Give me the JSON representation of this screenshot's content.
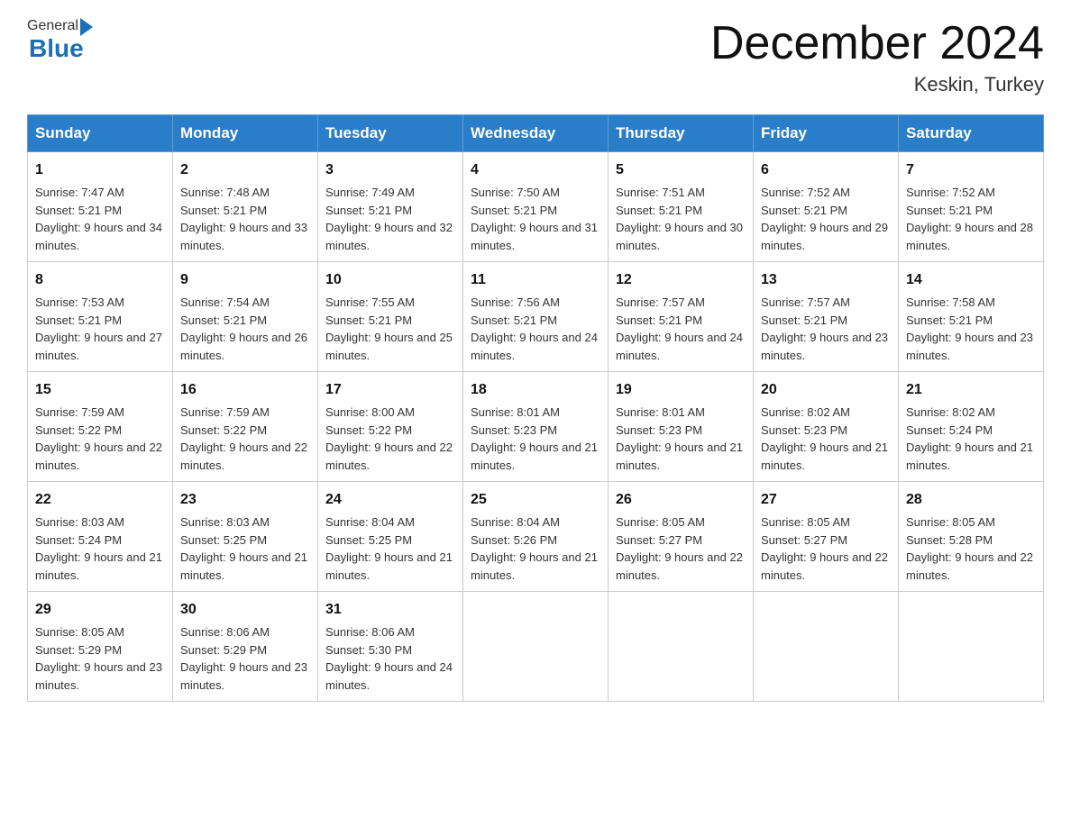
{
  "header": {
    "logo_general": "General",
    "logo_blue": "Blue",
    "month_title": "December 2024",
    "location": "Keskin, Turkey"
  },
  "weekdays": [
    "Sunday",
    "Monday",
    "Tuesday",
    "Wednesday",
    "Thursday",
    "Friday",
    "Saturday"
  ],
  "weeks": [
    [
      {
        "day": "1",
        "sunrise": "7:47 AM",
        "sunset": "5:21 PM",
        "daylight": "9 hours and 34 minutes."
      },
      {
        "day": "2",
        "sunrise": "7:48 AM",
        "sunset": "5:21 PM",
        "daylight": "9 hours and 33 minutes."
      },
      {
        "day": "3",
        "sunrise": "7:49 AM",
        "sunset": "5:21 PM",
        "daylight": "9 hours and 32 minutes."
      },
      {
        "day": "4",
        "sunrise": "7:50 AM",
        "sunset": "5:21 PM",
        "daylight": "9 hours and 31 minutes."
      },
      {
        "day": "5",
        "sunrise": "7:51 AM",
        "sunset": "5:21 PM",
        "daylight": "9 hours and 30 minutes."
      },
      {
        "day": "6",
        "sunrise": "7:52 AM",
        "sunset": "5:21 PM",
        "daylight": "9 hours and 29 minutes."
      },
      {
        "day": "7",
        "sunrise": "7:52 AM",
        "sunset": "5:21 PM",
        "daylight": "9 hours and 28 minutes."
      }
    ],
    [
      {
        "day": "8",
        "sunrise": "7:53 AM",
        "sunset": "5:21 PM",
        "daylight": "9 hours and 27 minutes."
      },
      {
        "day": "9",
        "sunrise": "7:54 AM",
        "sunset": "5:21 PM",
        "daylight": "9 hours and 26 minutes."
      },
      {
        "day": "10",
        "sunrise": "7:55 AM",
        "sunset": "5:21 PM",
        "daylight": "9 hours and 25 minutes."
      },
      {
        "day": "11",
        "sunrise": "7:56 AM",
        "sunset": "5:21 PM",
        "daylight": "9 hours and 24 minutes."
      },
      {
        "day": "12",
        "sunrise": "7:57 AM",
        "sunset": "5:21 PM",
        "daylight": "9 hours and 24 minutes."
      },
      {
        "day": "13",
        "sunrise": "7:57 AM",
        "sunset": "5:21 PM",
        "daylight": "9 hours and 23 minutes."
      },
      {
        "day": "14",
        "sunrise": "7:58 AM",
        "sunset": "5:21 PM",
        "daylight": "9 hours and 23 minutes."
      }
    ],
    [
      {
        "day": "15",
        "sunrise": "7:59 AM",
        "sunset": "5:22 PM",
        "daylight": "9 hours and 22 minutes."
      },
      {
        "day": "16",
        "sunrise": "7:59 AM",
        "sunset": "5:22 PM",
        "daylight": "9 hours and 22 minutes."
      },
      {
        "day": "17",
        "sunrise": "8:00 AM",
        "sunset": "5:22 PM",
        "daylight": "9 hours and 22 minutes."
      },
      {
        "day": "18",
        "sunrise": "8:01 AM",
        "sunset": "5:23 PM",
        "daylight": "9 hours and 21 minutes."
      },
      {
        "day": "19",
        "sunrise": "8:01 AM",
        "sunset": "5:23 PM",
        "daylight": "9 hours and 21 minutes."
      },
      {
        "day": "20",
        "sunrise": "8:02 AM",
        "sunset": "5:23 PM",
        "daylight": "9 hours and 21 minutes."
      },
      {
        "day": "21",
        "sunrise": "8:02 AM",
        "sunset": "5:24 PM",
        "daylight": "9 hours and 21 minutes."
      }
    ],
    [
      {
        "day": "22",
        "sunrise": "8:03 AM",
        "sunset": "5:24 PM",
        "daylight": "9 hours and 21 minutes."
      },
      {
        "day": "23",
        "sunrise": "8:03 AM",
        "sunset": "5:25 PM",
        "daylight": "9 hours and 21 minutes."
      },
      {
        "day": "24",
        "sunrise": "8:04 AM",
        "sunset": "5:25 PM",
        "daylight": "9 hours and 21 minutes."
      },
      {
        "day": "25",
        "sunrise": "8:04 AM",
        "sunset": "5:26 PM",
        "daylight": "9 hours and 21 minutes."
      },
      {
        "day": "26",
        "sunrise": "8:05 AM",
        "sunset": "5:27 PM",
        "daylight": "9 hours and 22 minutes."
      },
      {
        "day": "27",
        "sunrise": "8:05 AM",
        "sunset": "5:27 PM",
        "daylight": "9 hours and 22 minutes."
      },
      {
        "day": "28",
        "sunrise": "8:05 AM",
        "sunset": "5:28 PM",
        "daylight": "9 hours and 22 minutes."
      }
    ],
    [
      {
        "day": "29",
        "sunrise": "8:05 AM",
        "sunset": "5:29 PM",
        "daylight": "9 hours and 23 minutes."
      },
      {
        "day": "30",
        "sunrise": "8:06 AM",
        "sunset": "5:29 PM",
        "daylight": "9 hours and 23 minutes."
      },
      {
        "day": "31",
        "sunrise": "8:06 AM",
        "sunset": "5:30 PM",
        "daylight": "9 hours and 24 minutes."
      },
      null,
      null,
      null,
      null
    ]
  ],
  "labels": {
    "sunrise_prefix": "Sunrise: ",
    "sunset_prefix": "Sunset: ",
    "daylight_prefix": "Daylight: "
  }
}
